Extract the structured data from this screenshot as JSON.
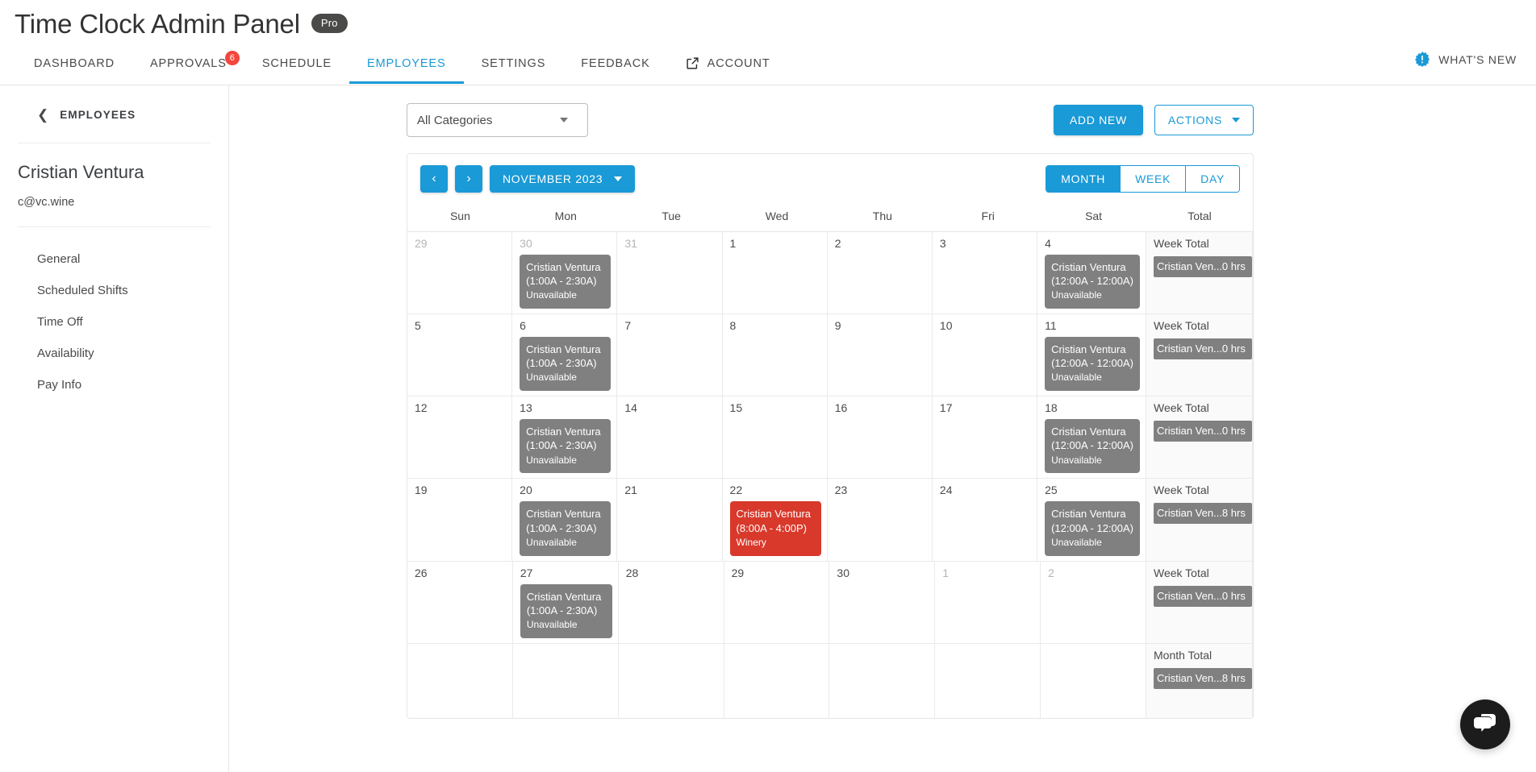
{
  "header": {
    "title": "Time Clock Admin Panel",
    "plan_badge": "Pro",
    "whats_new_label": "WHAT'S NEW",
    "accent_color": "#1a9ad7",
    "badge_color": "#f4463c",
    "tabs": [
      {
        "label": "DASHBOARD",
        "active": false,
        "badge": null,
        "icon": null
      },
      {
        "label": "APPROVALS",
        "active": false,
        "badge": "6",
        "icon": null
      },
      {
        "label": "SCHEDULE",
        "active": false,
        "badge": null,
        "icon": null
      },
      {
        "label": "EMPLOYEES",
        "active": true,
        "badge": null,
        "icon": null
      },
      {
        "label": "SETTINGS",
        "active": false,
        "badge": null,
        "icon": null
      },
      {
        "label": "FEEDBACK",
        "active": false,
        "badge": null,
        "icon": null
      },
      {
        "label": "ACCOUNT",
        "active": false,
        "badge": null,
        "icon": "external-link-icon"
      }
    ]
  },
  "sidebar": {
    "back_label": "EMPLOYEES",
    "person_name": "Cristian Ventura",
    "person_email": "c@vc.wine",
    "items": [
      {
        "label": "General"
      },
      {
        "label": "Scheduled Shifts"
      },
      {
        "label": "Time Off"
      },
      {
        "label": "Availability"
      },
      {
        "label": "Pay Info"
      }
    ]
  },
  "toolbar": {
    "category_select": "All Categories",
    "add_new_label": "ADD NEW",
    "actions_label": "ACTIONS"
  },
  "calendar": {
    "prev_label": "‹",
    "next_label": "›",
    "period_label": "NOVEMBER 2023",
    "views": [
      {
        "label": "MONTH",
        "active": true
      },
      {
        "label": "WEEK",
        "active": false
      },
      {
        "label": "DAY",
        "active": false
      }
    ],
    "day_headers": [
      "Sun",
      "Mon",
      "Tue",
      "Wed",
      "Thu",
      "Fri",
      "Sat",
      "Total"
    ],
    "event_colors": {
      "unavailable": "#808080",
      "winery": "#d8392b"
    },
    "weeks": [
      {
        "days": [
          {
            "num": "29",
            "muted": true,
            "events": []
          },
          {
            "num": "30",
            "muted": true,
            "events": [
              {
                "title": "Cristian Ventura",
                "time": "(1:00A - 2:30A)",
                "label": "Unavailable",
                "color": "gray"
              }
            ]
          },
          {
            "num": "31",
            "muted": true,
            "events": []
          },
          {
            "num": "1",
            "muted": false,
            "events": []
          },
          {
            "num": "2",
            "muted": false,
            "events": []
          },
          {
            "num": "3",
            "muted": false,
            "events": []
          },
          {
            "num": "4",
            "muted": false,
            "events": [
              {
                "title": "Cristian Ventura",
                "time": "(12:00A - 12:00A)",
                "label": "Unavailable",
                "color": "gray"
              }
            ]
          }
        ],
        "total_label": "Week Total",
        "total_value": "Cristian Ven...0 hrs"
      },
      {
        "days": [
          {
            "num": "5",
            "muted": false,
            "events": []
          },
          {
            "num": "6",
            "muted": false,
            "events": [
              {
                "title": "Cristian Ventura",
                "time": "(1:00A - 2:30A)",
                "label": "Unavailable",
                "color": "gray"
              }
            ]
          },
          {
            "num": "7",
            "muted": false,
            "events": []
          },
          {
            "num": "8",
            "muted": false,
            "events": []
          },
          {
            "num": "9",
            "muted": false,
            "events": []
          },
          {
            "num": "10",
            "muted": false,
            "events": []
          },
          {
            "num": "11",
            "muted": false,
            "events": [
              {
                "title": "Cristian Ventura",
                "time": "(12:00A - 12:00A)",
                "label": "Unavailable",
                "color": "gray"
              }
            ]
          }
        ],
        "total_label": "Week Total",
        "total_value": "Cristian Ven...0 hrs"
      },
      {
        "days": [
          {
            "num": "12",
            "muted": false,
            "events": []
          },
          {
            "num": "13",
            "muted": false,
            "events": [
              {
                "title": "Cristian Ventura",
                "time": "(1:00A - 2:30A)",
                "label": "Unavailable",
                "color": "gray"
              }
            ]
          },
          {
            "num": "14",
            "muted": false,
            "events": []
          },
          {
            "num": "15",
            "muted": false,
            "events": []
          },
          {
            "num": "16",
            "muted": false,
            "events": []
          },
          {
            "num": "17",
            "muted": false,
            "events": []
          },
          {
            "num": "18",
            "muted": false,
            "events": [
              {
                "title": "Cristian Ventura",
                "time": "(12:00A - 12:00A)",
                "label": "Unavailable",
                "color": "gray"
              }
            ]
          }
        ],
        "total_label": "Week Total",
        "total_value": "Cristian Ven...0 hrs"
      },
      {
        "days": [
          {
            "num": "19",
            "muted": false,
            "events": []
          },
          {
            "num": "20",
            "muted": false,
            "events": [
              {
                "title": "Cristian Ventura",
                "time": "(1:00A - 2:30A)",
                "label": "Unavailable",
                "color": "gray"
              }
            ]
          },
          {
            "num": "21",
            "muted": false,
            "events": []
          },
          {
            "num": "22",
            "muted": false,
            "events": [
              {
                "title": "Cristian Ventura",
                "time": "(8:00A - 4:00P)",
                "label": "Winery",
                "color": "red"
              }
            ]
          },
          {
            "num": "23",
            "muted": false,
            "events": []
          },
          {
            "num": "24",
            "muted": false,
            "events": []
          },
          {
            "num": "25",
            "muted": false,
            "events": [
              {
                "title": "Cristian Ventura",
                "time": "(12:00A - 12:00A)",
                "label": "Unavailable",
                "color": "gray"
              }
            ]
          }
        ],
        "total_label": "Week Total",
        "total_value": "Cristian Ven...8 hrs"
      },
      {
        "days": [
          {
            "num": "26",
            "muted": false,
            "events": []
          },
          {
            "num": "27",
            "muted": false,
            "events": [
              {
                "title": "Cristian Ventura",
                "time": "(1:00A - 2:30A)",
                "label": "Unavailable",
                "color": "gray"
              }
            ]
          },
          {
            "num": "28",
            "muted": false,
            "events": []
          },
          {
            "num": "29",
            "muted": false,
            "events": []
          },
          {
            "num": "30",
            "muted": false,
            "events": []
          },
          {
            "num": "1",
            "muted": true,
            "events": []
          },
          {
            "num": "2",
            "muted": true,
            "events": []
          }
        ],
        "total_label": "Week Total",
        "total_value": "Cristian Ven...0 hrs"
      },
      {
        "days": [
          {
            "num": "",
            "muted": false,
            "events": []
          },
          {
            "num": "",
            "muted": false,
            "events": []
          },
          {
            "num": "",
            "muted": false,
            "events": []
          },
          {
            "num": "",
            "muted": false,
            "events": []
          },
          {
            "num": "",
            "muted": false,
            "events": []
          },
          {
            "num": "",
            "muted": false,
            "events": []
          },
          {
            "num": "",
            "muted": false,
            "events": []
          }
        ],
        "total_label": "Month Total",
        "total_value": "Cristian Ven...8 hrs"
      }
    ]
  },
  "chat": {
    "icon": "chat-bubbles-icon"
  }
}
